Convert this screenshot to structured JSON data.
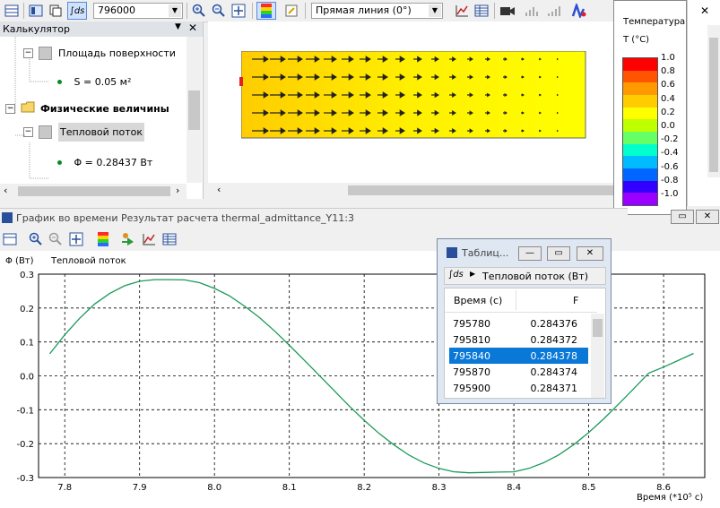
{
  "toolbar": {
    "time_value": "796000",
    "line_mode": "Прямая линия (0°)",
    "integral_icon_label": "∫ds"
  },
  "calculator": {
    "title": "Калькулятор",
    "items": [
      {
        "label": "Площадь поверхности",
        "kind": "node"
      },
      {
        "label": "S = 0.05 м²",
        "kind": "value"
      },
      {
        "label": "Физические величины",
        "kind": "folder"
      },
      {
        "label": "Тепловой поток",
        "kind": "node"
      },
      {
        "label": "Φ = 0.28437 Вт",
        "kind": "value"
      }
    ]
  },
  "legend": {
    "title": "Температура",
    "unit": "T (°C)",
    "ticks": [
      "1.0",
      "0.8",
      "0.6",
      "0.4",
      "0.2",
      "0.0",
      "-0.2",
      "-0.4",
      "-0.6",
      "-0.8",
      "-1.0"
    ],
    "colors": [
      "#ff0000",
      "#ff5500",
      "#ff9900",
      "#ffcc00",
      "#ffff00",
      "#bfff00",
      "#66ff66",
      "#00ffcc",
      "#00bbff",
      "#0066ff",
      "#3300ff",
      "#9900ff"
    ]
  },
  "graph_window": {
    "title": "График во времени Результат расчета thermal_admittance_Y11:3"
  },
  "table_window": {
    "title": "Таблиц...",
    "quantity": "Тепловой поток (Вт)",
    "col_time": "Время (с)",
    "col_f": "F",
    "rows": [
      {
        "time": "795780",
        "f": "0.284376"
      },
      {
        "time": "795810",
        "f": "0.284372"
      },
      {
        "time": "795840",
        "f": "0.284378"
      },
      {
        "time": "795870",
        "f": "0.284374"
      },
      {
        "time": "795900",
        "f": "0.284371"
      }
    ],
    "selected_index": 2
  },
  "chart_data": {
    "type": "line",
    "ylabel": "Φ (Вт)",
    "series_label": "Тепловой поток",
    "xlabel": "Время (*10⁵ с)",
    "xlim": [
      7.765,
      8.655
    ],
    "ylim": [
      -0.3,
      0.3
    ],
    "x_ticks": [
      "7.8",
      "7.9",
      "8.0",
      "8.1",
      "8.2",
      "8.3",
      "8.4",
      "8.5",
      "8.6"
    ],
    "x_tick_values": [
      7.8,
      7.9,
      8.0,
      8.1,
      8.2,
      8.3,
      8.4,
      8.5,
      8.6
    ],
    "y_ticks": [
      "0.3",
      "0.2",
      "0.1",
      "0.0",
      "-0.1",
      "-0.2",
      "-0.3"
    ],
    "y_tick_values": [
      0.3,
      0.2,
      0.1,
      0.0,
      -0.1,
      -0.2,
      -0.3
    ],
    "grid": true,
    "line_color": "#1a9a5a",
    "series": [
      {
        "x": [
          7.78,
          7.8,
          7.82,
          7.84,
          7.86,
          7.88,
          7.9,
          7.92,
          7.94,
          7.96,
          7.98,
          8.0,
          8.02,
          8.04,
          8.06,
          8.08,
          8.1,
          8.12,
          8.14,
          8.16,
          8.18,
          8.2,
          8.22,
          8.24,
          8.26,
          8.28,
          8.3,
          8.32,
          8.34,
          8.36,
          8.38,
          8.4,
          8.42,
          8.44,
          8.46,
          8.48,
          8.5,
          8.52,
          8.54,
          8.56,
          8.58,
          8.6,
          8.62,
          8.64
        ],
        "y": [
          0.065,
          0.121,
          0.17,
          0.212,
          0.243,
          0.266,
          0.279,
          0.284,
          0.284,
          0.283,
          0.275,
          0.258,
          0.236,
          0.206,
          0.172,
          0.133,
          0.09,
          0.046,
          0.001,
          -0.044,
          -0.089,
          -0.131,
          -0.17,
          -0.204,
          -0.234,
          -0.257,
          -0.273,
          -0.283,
          -0.286,
          -0.285,
          -0.284,
          -0.283,
          -0.273,
          -0.256,
          -0.233,
          -0.203,
          -0.167,
          -0.127,
          -0.083,
          -0.038,
          0.008,
          0.026,
          0.046,
          0.066
        ]
      }
    ]
  }
}
